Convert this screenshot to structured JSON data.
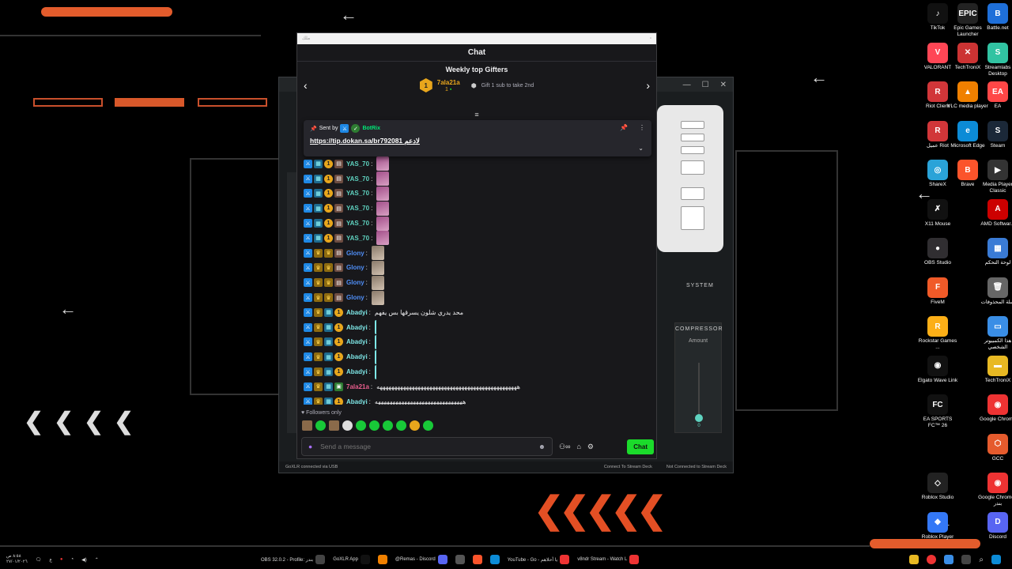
{
  "chat": {
    "frame_label": "ملك",
    "title": "Chat",
    "gifters": {
      "title": "Weekly top Gifters",
      "prev_icon": "‹",
      "next_icon": "›",
      "rank": "1",
      "top_name": "7ala21a",
      "top_count": "1",
      "hint": "Gift 1 sub to take 2nd"
    },
    "pinned": {
      "sent_by_label": "Sent by",
      "bot_name": "BotRix",
      "link_text": "https://tip.dokan.sa/br792081 لادعم"
    },
    "messages": [
      {
        "user": "YAS_70",
        "color": "#5fd3c0",
        "badges": [
          "mod",
          "sub",
          "coin",
          "chest"
        ],
        "emote": "hand",
        "text": ""
      },
      {
        "user": "YAS_70",
        "color": "#5fd3c0",
        "badges": [
          "mod",
          "sub",
          "coin",
          "chest"
        ],
        "emote": "hand",
        "text": ""
      },
      {
        "user": "YAS_70",
        "color": "#5fd3c0",
        "badges": [
          "mod",
          "sub",
          "coin",
          "chest"
        ],
        "emote": "hand",
        "text": ""
      },
      {
        "user": "YAS_70",
        "color": "#5fd3c0",
        "badges": [
          "mod",
          "sub",
          "coin",
          "chest"
        ],
        "emote": "hand",
        "text": ""
      },
      {
        "user": "YAS_70",
        "color": "#5fd3c0",
        "badges": [
          "mod",
          "sub",
          "coin",
          "chest"
        ],
        "emote": "hand",
        "text": ""
      },
      {
        "user": "YAS_70",
        "color": "#5fd3c0",
        "badges": [
          "mod",
          "sub",
          "coin",
          "chest"
        ],
        "emote": "hand",
        "text": ""
      },
      {
        "user": "Glony",
        "color": "#4f8ef7",
        "badges": [
          "mod",
          "crown",
          "crown",
          "chest"
        ],
        "emote": "face",
        "text": ""
      },
      {
        "user": "Glony",
        "color": "#4f8ef7",
        "badges": [
          "mod",
          "crown",
          "crown",
          "chest"
        ],
        "emote": "face",
        "text": ""
      },
      {
        "user": "Glony",
        "color": "#4f8ef7",
        "badges": [
          "mod",
          "crown",
          "crown",
          "chest"
        ],
        "emote": "face",
        "text": ""
      },
      {
        "user": "Glony",
        "color": "#4f8ef7",
        "badges": [
          "mod",
          "crown",
          "crown",
          "chest"
        ],
        "emote": "face",
        "text": ""
      },
      {
        "user": "Abadyi",
        "color": "#7ee7e7",
        "badges": [
          "mod",
          "crown",
          "sub",
          "coin"
        ],
        "emote": "",
        "text": "محد يدري شلون يسرقها بس يفهم"
      },
      {
        "user": "Abadyi",
        "color": "#7ee7e7",
        "badges": [
          "mod",
          "crown",
          "sub",
          "coin"
        ],
        "emote": "skel",
        "text": ""
      },
      {
        "user": "Abadyi",
        "color": "#7ee7e7",
        "badges": [
          "mod",
          "crown",
          "sub",
          "coin"
        ],
        "emote": "skel",
        "text": ""
      },
      {
        "user": "Abadyi",
        "color": "#7ee7e7",
        "badges": [
          "mod",
          "crown",
          "sub",
          "coin"
        ],
        "emote": "skel",
        "text": ""
      },
      {
        "user": "Abadyi",
        "color": "#7ee7e7",
        "badges": [
          "mod",
          "crown",
          "sub",
          "coin"
        ],
        "emote": "skel",
        "text": ""
      },
      {
        "user": "7ala21a",
        "color": "#e85d8c",
        "badges": [
          "mod",
          "crown",
          "sub",
          "gift"
        ],
        "emote": "",
        "text": "ههههههههههههههههههههههههههههههههههههههههههههههههه"
      },
      {
        "user": "Abadyi",
        "color": "#7ee7e7",
        "badges": [
          "mod",
          "crown",
          "sub",
          "coin"
        ],
        "emote": "",
        "text": "ههههههههههههههههههههههههههههههه"
      }
    ],
    "followers_label": "Followers only",
    "input_placeholder": "Send a message",
    "send_label": "Chat"
  },
  "goxlr": {
    "system_label": "SYSTEM",
    "compressor_label": "COMPRESSOR",
    "amount_label": "Amount",
    "amount_value": "0",
    "status_left": "GoXLR connected via USB",
    "status_mid": "Connect To Stream Deck",
    "status_right": "Not Connected to Stream Deck"
  },
  "desktop_icons": [
    {
      "label": "TikTok",
      "color": "#111",
      "glyph": "♪"
    },
    {
      "label": "Epic Games Launcher",
      "color": "#222",
      "glyph": "EPIC"
    },
    {
      "label": "Battle.net",
      "color": "#1e6fd9",
      "glyph": "B"
    },
    {
      "label": "VALORANT",
      "color": "#ff4655",
      "glyph": "V"
    },
    {
      "label": "TechTroniX",
      "color": "#c33",
      "glyph": "✕"
    },
    {
      "label": "Streamlabs Desktop",
      "color": "#31c3a2",
      "glyph": "S"
    },
    {
      "label": "Riot Client",
      "color": "#d13639",
      "glyph": "R"
    },
    {
      "label": "VLC media player",
      "color": "#f08000",
      "glyph": "▲"
    },
    {
      "label": "EA",
      "color": "#ff4747",
      "glyph": "EA"
    },
    {
      "label": "عميل Riot",
      "color": "#d13639",
      "glyph": "R"
    },
    {
      "label": "Microsoft Edge",
      "color": "#0c8bd6",
      "glyph": "e"
    },
    {
      "label": "Steam",
      "color": "#1b2838",
      "glyph": "S"
    },
    {
      "label": "ShareX",
      "color": "#2aa3d8",
      "glyph": "◎"
    },
    {
      "label": "Brave",
      "color": "#fb542b",
      "glyph": "B"
    },
    {
      "label": "Media Player Classic",
      "color": "#333",
      "glyph": "▶"
    },
    {
      "label": "X11 Mouse",
      "color": "#111",
      "glyph": "✗"
    },
    {
      "label": "",
      "color": "#000",
      "glyph": ""
    },
    {
      "label": "AMD Softwar...",
      "color": "#c00",
      "glyph": "A"
    },
    {
      "label": "OBS Studio",
      "color": "#302e31",
      "glyph": "●"
    },
    {
      "label": "",
      "color": "#000",
      "glyph": ""
    },
    {
      "label": "لوحة التحكم",
      "color": "#3a7bd5",
      "glyph": "▦"
    },
    {
      "label": "FiveM",
      "color": "#f05a28",
      "glyph": "F"
    },
    {
      "label": "",
      "color": "#000",
      "glyph": ""
    },
    {
      "label": "سلة المحذوفات",
      "color": "#666",
      "glyph": "🗑"
    },
    {
      "label": "Rockstar Games ...",
      "color": "#fcaf17",
      "glyph": "R"
    },
    {
      "label": "",
      "color": "#000",
      "glyph": ""
    },
    {
      "label": "هذا الكمبيوتر الشخصي",
      "color": "#3a8ee6",
      "glyph": "▭"
    },
    {
      "label": "Elgato Wave Link",
      "color": "#111",
      "glyph": "◉"
    },
    {
      "label": "",
      "color": "#000",
      "glyph": ""
    },
    {
      "label": "TechTroniX",
      "color": "#e8b923",
      "glyph": "▬"
    },
    {
      "label": "EA SPORTS FC™ 26",
      "color": "#111",
      "glyph": "FC"
    },
    {
      "label": "",
      "color": "#000",
      "glyph": ""
    },
    {
      "label": "Google Chrome",
      "color": "#e33",
      "glyph": "◉"
    },
    {
      "label": "",
      "color": "#000",
      "glyph": ""
    },
    {
      "label": "",
      "color": "#000",
      "glyph": ""
    },
    {
      "label": "GCC",
      "color": "#e55b2d",
      "glyph": "⬡"
    },
    {
      "label": "Roblox Studio",
      "color": "#222",
      "glyph": "◇"
    },
    {
      "label": "",
      "color": "#000",
      "glyph": ""
    },
    {
      "label": "Google Chrome - بندر",
      "color": "#e33",
      "glyph": "◉"
    },
    {
      "label": "Roblox Player",
      "color": "#3478f6",
      "glyph": "◆"
    },
    {
      "label": "",
      "color": "#000",
      "glyph": ""
    },
    {
      "label": "Discord",
      "color": "#5865f2",
      "glyph": "D"
    }
  ],
  "taskbar": {
    "clock": "٨:٥٨ ص",
    "date": "٢٧/٠١/٢٠٢٦",
    "items": [
      {
        "label": "OBS 32.0.2 - Profile: بندر",
        "color": "#444"
      },
      {
        "label": "GoXLR App",
        "color": "#111"
      },
      {
        "label": "",
        "color": "#f08000"
      },
      {
        "label": "@Remas - Discord",
        "color": "#5865f2"
      },
      {
        "label": "",
        "color": "#555"
      },
      {
        "label": "",
        "color": "#fb542b"
      },
      {
        "label": "",
        "color": "#0c8bd6"
      },
      {
        "label": "YouTube - Go - يا أحلاهم",
        "color": "#e33"
      },
      {
        "label": "v8ndr Stream - Watch L",
        "color": "#e33"
      }
    ]
  }
}
